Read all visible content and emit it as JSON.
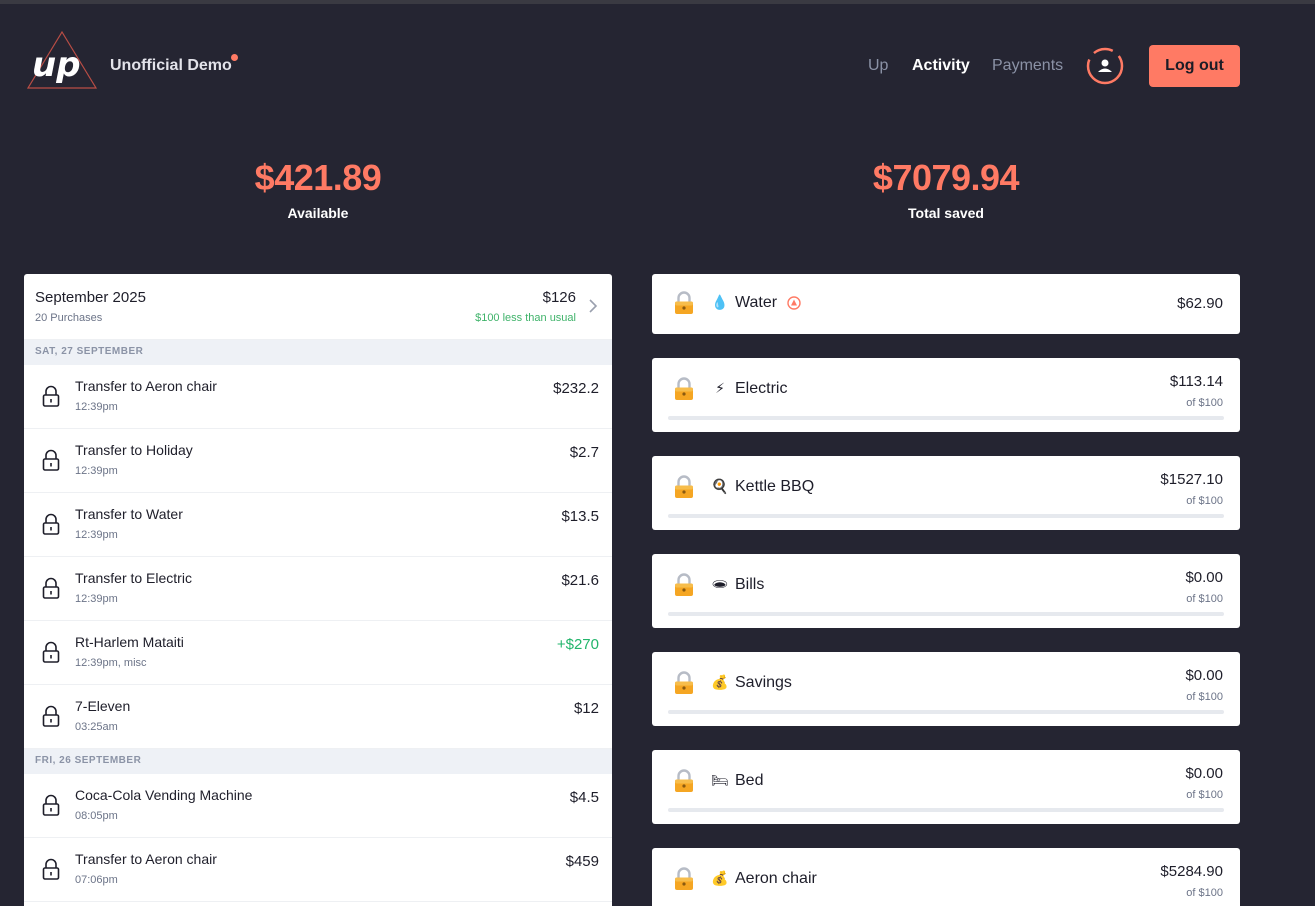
{
  "header": {
    "brand": "Unofficial Demo",
    "nav": [
      {
        "label": "Up"
      },
      {
        "label": "Activity"
      },
      {
        "label": "Payments"
      }
    ],
    "logout": "Log out",
    "accent": "#ff7a64"
  },
  "balances": {
    "available": {
      "amount": "$421.89",
      "label": "Available"
    },
    "saved": {
      "amount": "$7079.94",
      "label": "Total saved"
    }
  },
  "activity": {
    "month": {
      "title": "September 2025",
      "purchases": "20 Purchases",
      "amount": "$126",
      "comparison": "$100 less than usual"
    },
    "days": [
      {
        "label": "SAT, 27 SEPTEMBER",
        "transactions": [
          {
            "name": "Transfer to Aeron chair",
            "time": "12:39pm",
            "amount": "$232.2",
            "positive": false
          },
          {
            "name": "Transfer to Holiday",
            "time": "12:39pm",
            "amount": "$2.7",
            "positive": false
          },
          {
            "name": "Transfer to Water",
            "time": "12:39pm",
            "amount": "$13.5",
            "positive": false
          },
          {
            "name": "Transfer to Electric",
            "time": "12:39pm",
            "amount": "$21.6",
            "positive": false
          },
          {
            "name": "Rt-Harlem Mataiti",
            "time": "12:39pm, misc",
            "amount": "+$270",
            "positive": true
          },
          {
            "name": "7-Eleven",
            "time": "03:25am",
            "amount": "$12",
            "positive": false
          }
        ]
      },
      {
        "label": "FRI, 26 SEPTEMBER",
        "transactions": [
          {
            "name": "Coca-Cola Vending Machine",
            "time": "08:05pm",
            "amount": "$4.5",
            "positive": false
          },
          {
            "name": "Transfer to Aeron chair",
            "time": "07:06pm",
            "amount": "$459",
            "positive": false
          }
        ]
      }
    ]
  },
  "savers": [
    {
      "emoji": "💧",
      "name": "Water",
      "amount": "$62.90",
      "goal": "",
      "progress": null,
      "alert_icon": "warning-triangle-icon"
    },
    {
      "emoji": "⚡",
      "name": "Electric",
      "amount": "$113.14",
      "goal": "of $100",
      "progress": 0
    },
    {
      "emoji": "🍳",
      "name": "Kettle BBQ",
      "amount": "$1527.10",
      "goal": "of $100",
      "progress": 0
    },
    {
      "emoji": "🕳",
      "name": "Bills",
      "amount": "$0.00",
      "goal": "of $100",
      "progress": 0
    },
    {
      "emoji": "💰",
      "name": "Savings",
      "amount": "$0.00",
      "goal": "of $100",
      "progress": 0
    },
    {
      "emoji": "🛏",
      "name": "Bed",
      "amount": "$0.00",
      "goal": "of $100",
      "progress": 0
    },
    {
      "emoji": "💰",
      "name": "Aeron chair",
      "amount": "$5284.90",
      "goal": "of $100",
      "progress": 0
    }
  ]
}
